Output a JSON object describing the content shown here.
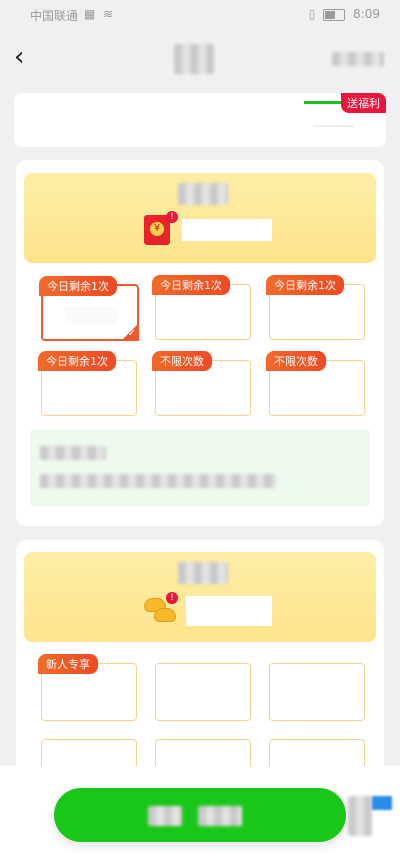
{
  "status_bar": {
    "carrier": "中国联通",
    "time": "8:09"
  },
  "nav": {
    "back_icon": "back-chevron-icon"
  },
  "promo": {
    "tag": "送福利",
    "accent": "#19c21e"
  },
  "vip_section": {
    "options": [
      {
        "tag": "今日剩余1次",
        "selected": true
      },
      {
        "tag": "今日剩余1次",
        "selected": false
      },
      {
        "tag": "今日剩余1次",
        "selected": false
      },
      {
        "tag": "今日剩余1次",
        "selected": false
      },
      {
        "tag": "不限次数",
        "selected": false
      },
      {
        "tag": "不限次数",
        "selected": false
      }
    ]
  },
  "coin_section": {
    "options": [
      {
        "tag": "新人专享"
      },
      {
        "tag": ""
      },
      {
        "tag": ""
      }
    ]
  },
  "colors": {
    "cta_green": "#19c719",
    "tag_orange": "#ee4a24",
    "banner_yellow": "#fde38c"
  }
}
